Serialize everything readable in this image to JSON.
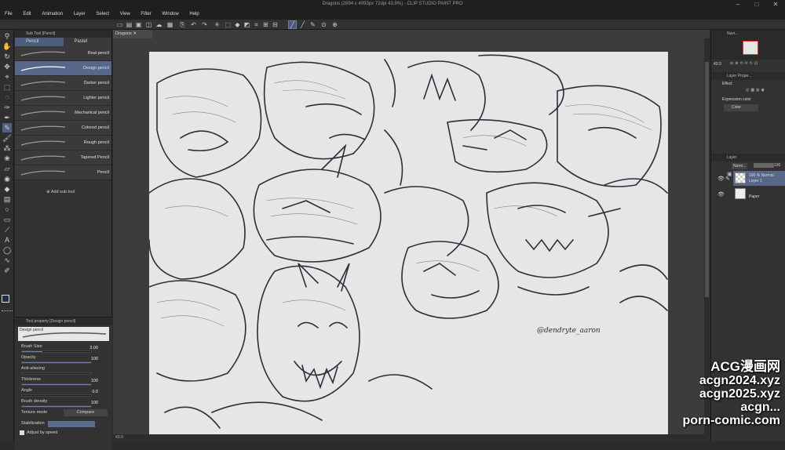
{
  "window": {
    "title": "Dragons (2894 x 4093px 72dpi 43.9%) - CLIP STUDIO PAINT PRO",
    "min": "–",
    "max": "□",
    "close": "✕"
  },
  "menu": [
    "File",
    "Edit",
    "Animation",
    "Layer",
    "Select",
    "View",
    "Filter",
    "Window",
    "Help"
  ],
  "subtool": {
    "header": "Sub Tool [Pencil]",
    "tabs": [
      "Pencil",
      "Pastel"
    ],
    "brushes": [
      "Real pencil",
      "Design pencil",
      "Darker pencil",
      "Lighter pencil",
      "Mechanical pencil",
      "Colored pencil",
      "Rough pencil",
      "Tapered Pencil",
      "Pencil"
    ],
    "selected_index": 1,
    "add_label": "Add sub tool"
  },
  "tool_property": {
    "header": "Tool property [Design pencil]",
    "preset": "Design pencil",
    "rows": [
      {
        "label": "Brush Size",
        "value": "3.00",
        "level": 0.3
      },
      {
        "label": "Opacity",
        "value": "100",
        "level": 1.0
      },
      {
        "label": "Anti-aliasing",
        "value": "",
        "level": 0
      },
      {
        "label": "Thickness",
        "value": "100",
        "level": 1.0
      },
      {
        "label": "Angle",
        "value": "0.0",
        "level": 0
      },
      {
        "label": "Brush density",
        "value": "100",
        "level": 1.0
      }
    ],
    "texture_label": "Texture mode",
    "texture_value": "Compare",
    "stabilization_label": "Stabilization",
    "adjust_label": "Adjust by speed"
  },
  "canvas": {
    "doc_tab": "Dragons",
    "zoom": "43.9",
    "signature": "@dendryte_aaron"
  },
  "right": {
    "navigator": "Navi...",
    "nav_zoom": "43.9",
    "layer_property": "Layer Prope...",
    "effect_label": "Effect",
    "expression_label": "Expression color",
    "expression_value": "Color",
    "layer_header": "Layer",
    "blend": "Norm...",
    "opacity": "100",
    "layers": [
      {
        "line1": "100 % Normal",
        "line2": "Layer 1"
      },
      {
        "line1": "",
        "line2": "Paper"
      }
    ]
  },
  "watermark": [
    "ACG漫画网",
    "acgn2024.xyz",
    "acgn2025.xyz",
    "acgn...",
    "porn-comic.com"
  ]
}
